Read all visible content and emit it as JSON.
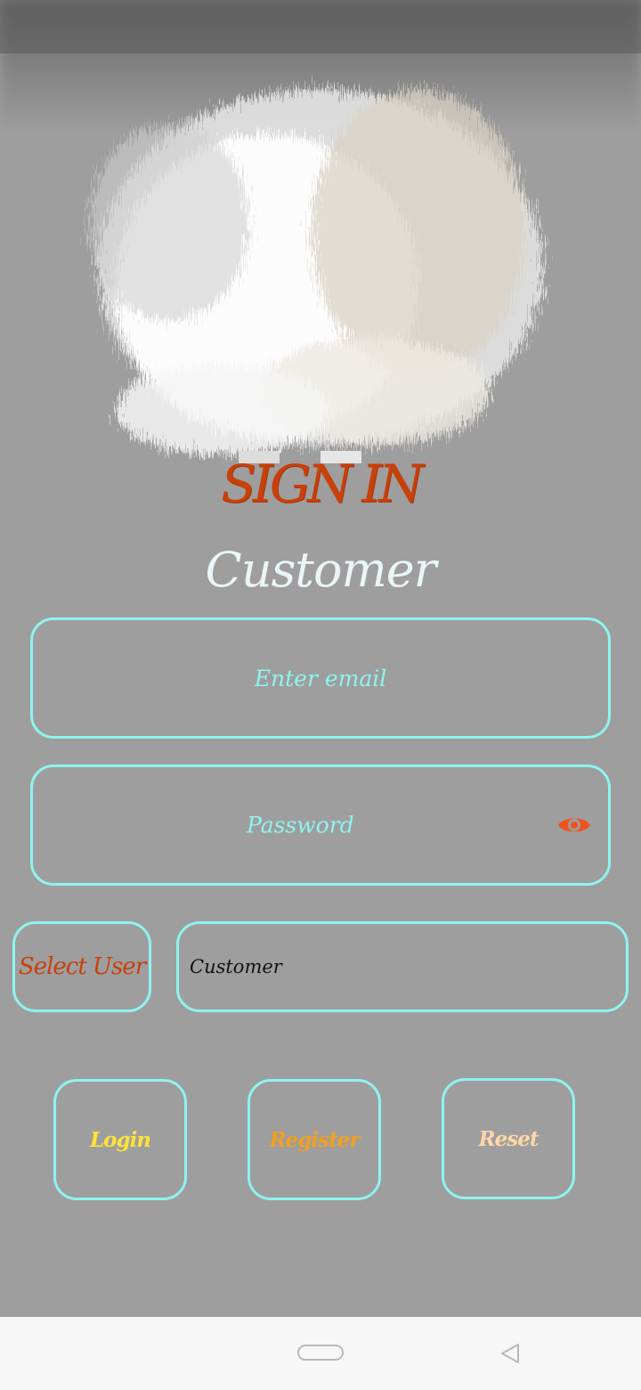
{
  "header": {
    "title": "SIGN IN",
    "subtitle": "Customer"
  },
  "form": {
    "email_placeholder": "Enter email",
    "password_placeholder": "Password",
    "password_toggle_icon": "eye-icon",
    "select_user_label": "Select User",
    "user_type_value": "Customer"
  },
  "buttons": {
    "login": "Login",
    "register": "Register",
    "reset": "Reset"
  },
  "colors": {
    "background": "#9e9e9e",
    "accent_border": "#8ff3ef",
    "title": "#c8400a",
    "login": "#ffe23a",
    "register": "#f0a020",
    "reset": "#ffd6a8",
    "eye_icon": "#f0521c"
  },
  "navigation_bar": {
    "icons": [
      "home-pill-icon",
      "back-triangle-icon"
    ]
  }
}
